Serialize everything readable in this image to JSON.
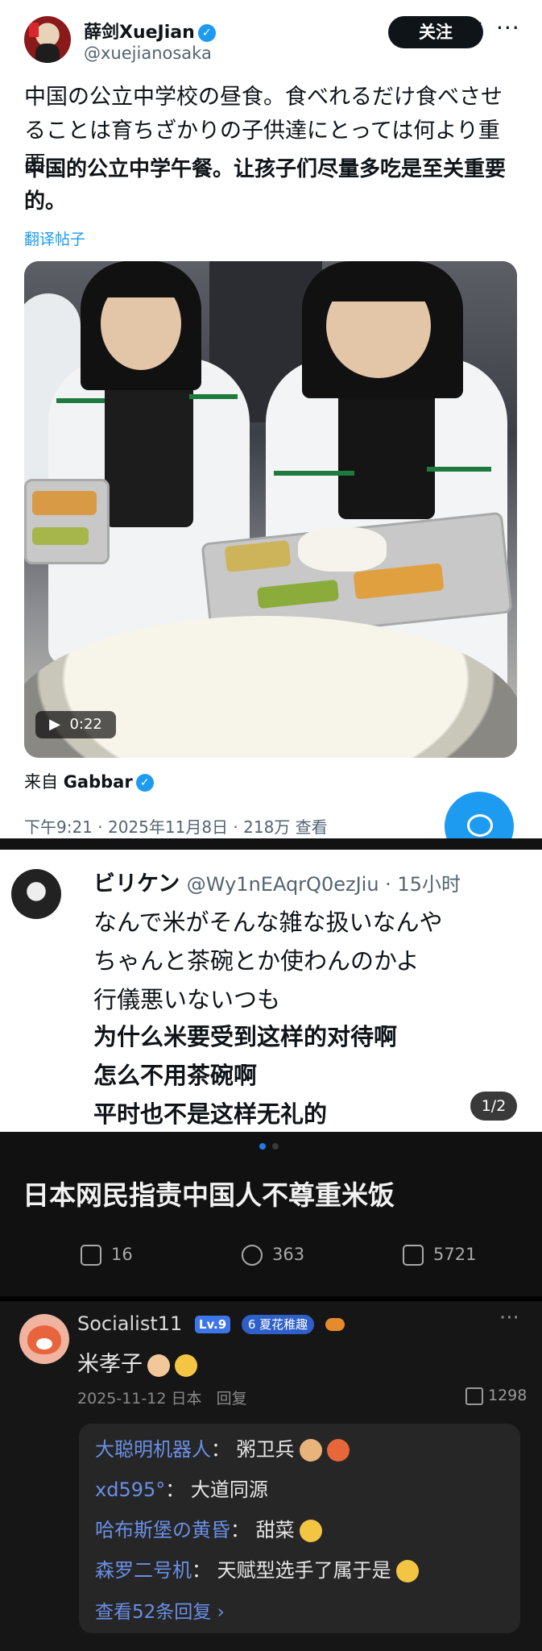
{
  "tweet": {
    "author_name": "薛剑XueJian",
    "author_handle": "@xuejianosaka",
    "follow_label": "关注",
    "more_label": "···",
    "text_jp": "中国の公立中学校の昼食。食べれるだけ食べさせることは育ちざかりの子供達にとっては何より重要。",
    "text_cn": "中国的公立中学午餐。让孩子们尽量多吃是至关重要的。",
    "translate_label": "翻译帖子",
    "video_duration": "0:22",
    "source_prefix": "来自",
    "source_name": "Gabbar",
    "timestamp": "下午9:21 · 2025年11月8日 · 218万 查看",
    "icons": [
      "verified-badge-icon",
      "grok-icon",
      "play-icon",
      "reply-fab-icon"
    ]
  },
  "reply_card": {
    "user_name": "ビリケン",
    "user_handle": "@Wy1nEAqrQ0ezJiu · 15小时",
    "text_jp": [
      "なんで米がそんな雑な扱いなんや",
      "ちゃんと茶碗とか使わんのかよ",
      "行儀悪いないつも"
    ],
    "text_cn": [
      "为什么米要受到这样的对待啊",
      "怎么不用茶碗啊",
      "平时也不是这样无礼的"
    ],
    "pager": "1/2"
  },
  "post": {
    "title": "日本网民指责中国人不尊重米饭",
    "stats": {
      "shares": "16",
      "comments": "363",
      "likes": "5721"
    },
    "dot_colors": [
      "#1d7af0",
      "#3a3a3a"
    ]
  },
  "comment": {
    "user_name": "Socialist11",
    "level": "Lv.9",
    "badge": "6 夏花稚趣",
    "more_label": "···",
    "text": "米孝子",
    "date_location": "2025-11-12 日本",
    "reply_label": "回复",
    "likes": "1298",
    "replies": [
      {
        "user": "大聪明机器人",
        "text": "粥卫兵"
      },
      {
        "user": "xd595°",
        "text": "大道同源"
      },
      {
        "user": "哈布斯堡の黄昏",
        "text": "甜菜"
      },
      {
        "user": "森罗二号机",
        "text": "天赋型选手了属于是"
      }
    ],
    "view_more": "查看52条回复 ›"
  }
}
